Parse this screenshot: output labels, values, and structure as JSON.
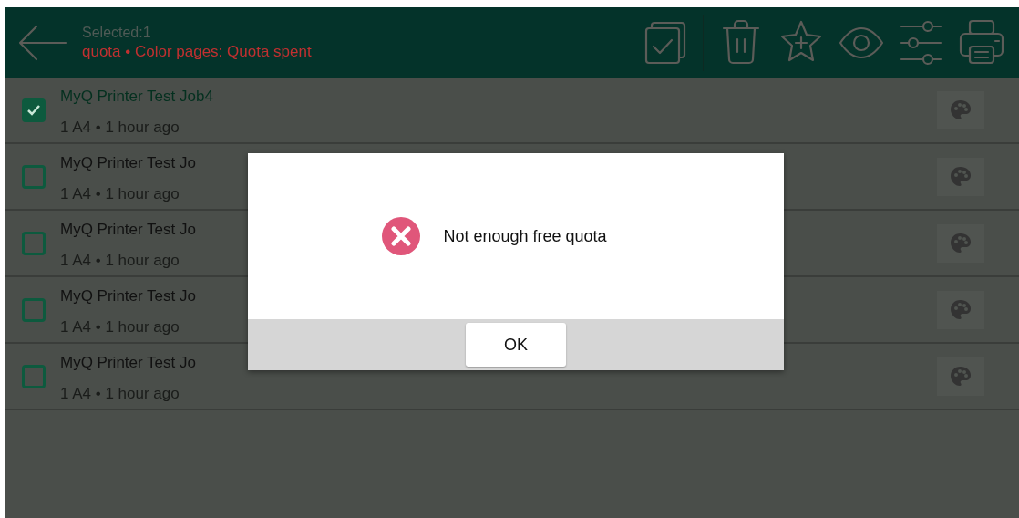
{
  "header": {
    "selected_count": "Selected:1",
    "quota_status": "quota • Color pages: Quota spent"
  },
  "jobs": [
    {
      "title": "MyQ Printer Test Job4",
      "details": "1 A4 • 1 hour ago",
      "selected": true
    },
    {
      "title": "MyQ Printer Test Jo",
      "details": "1 A4 • 1 hour ago",
      "selected": false
    },
    {
      "title": "MyQ Printer Test Jo",
      "details": "1 A4 • 1 hour ago",
      "selected": false
    },
    {
      "title": "MyQ Printer Test Jo",
      "details": "1 A4 • 1 hour ago",
      "selected": false
    },
    {
      "title": "MyQ Printer Test Jo",
      "details": "1 A4 • 1 hour ago",
      "selected": false
    }
  ],
  "dialog": {
    "message": "Not enough free quota",
    "button": "OK"
  }
}
